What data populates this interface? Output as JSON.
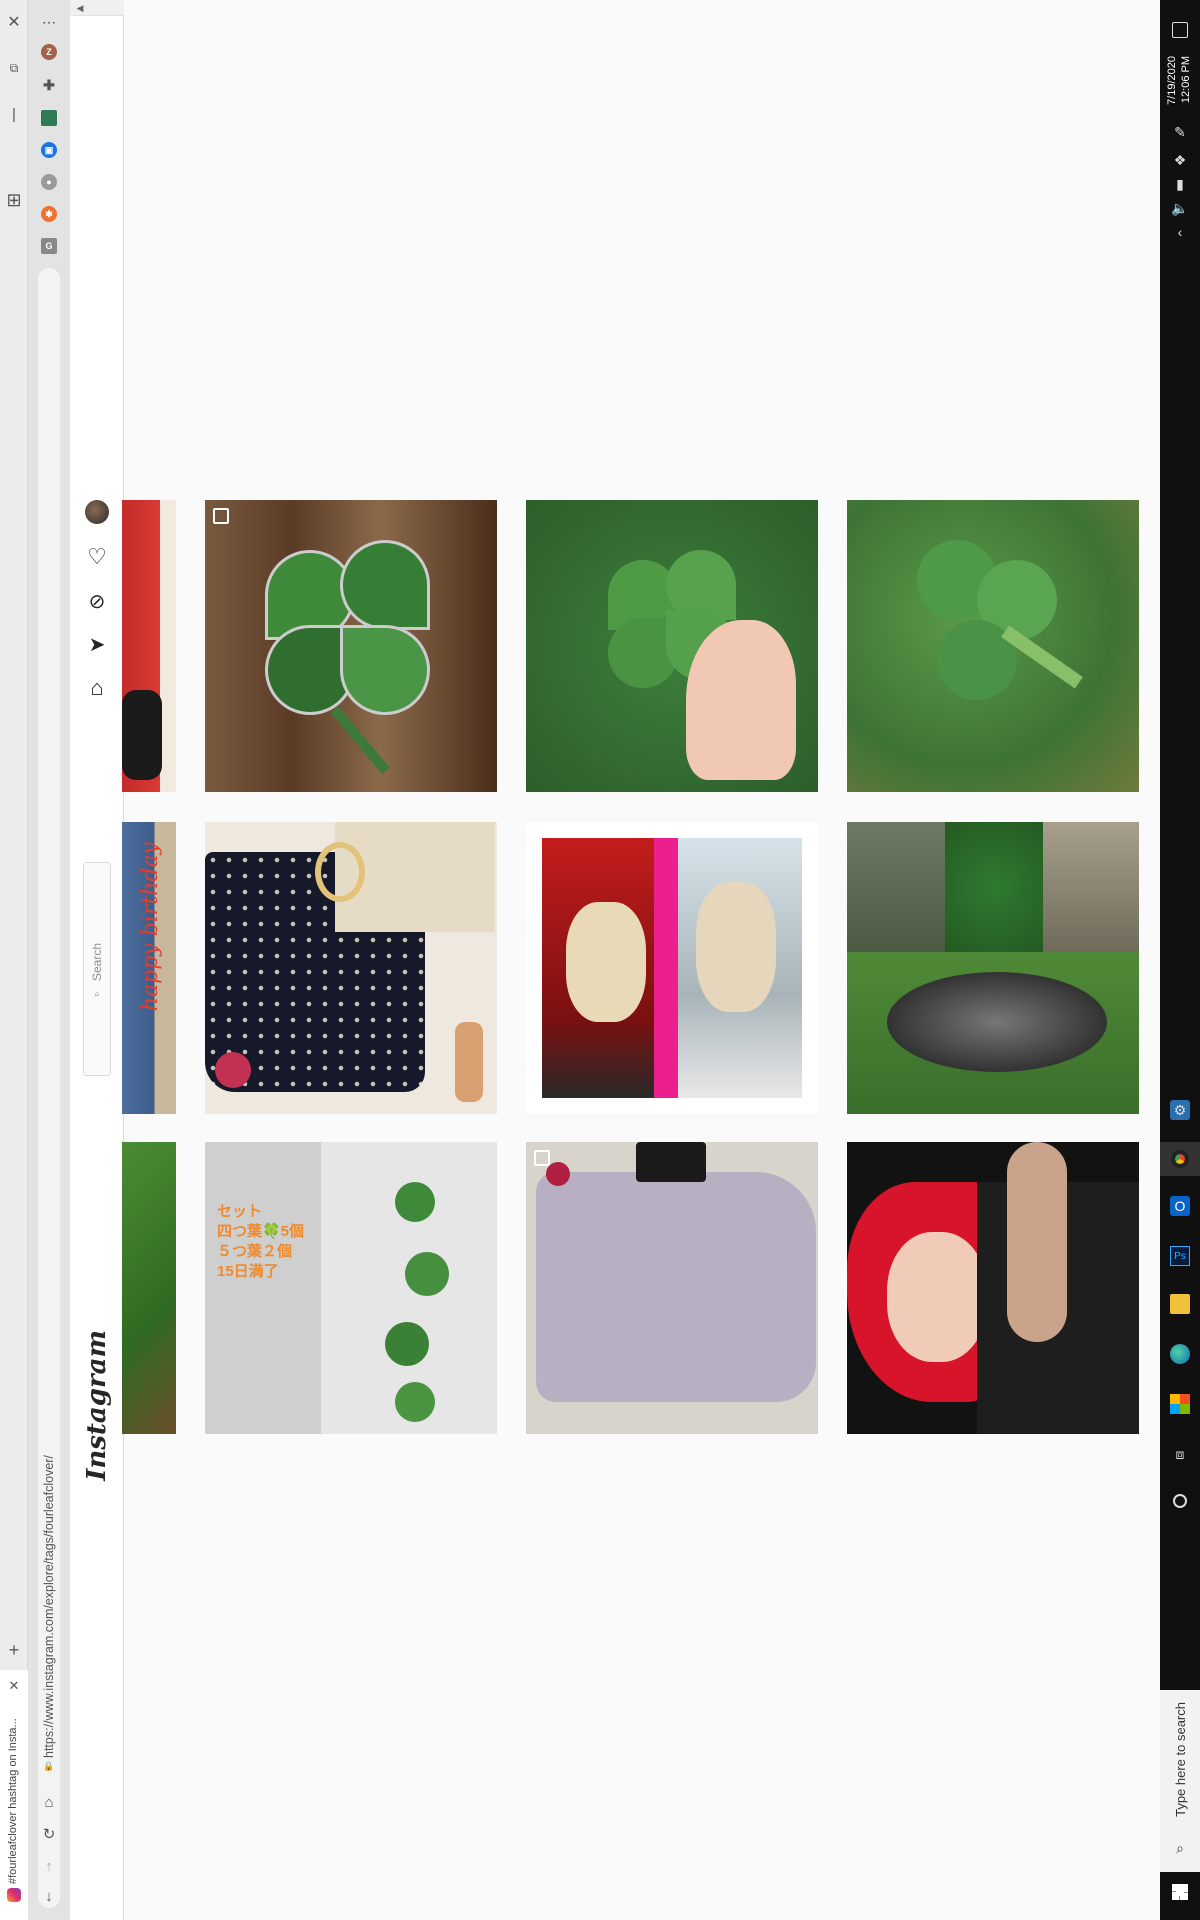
{
  "browser": {
    "tab_title": "#fourleafclover hashtag on Insta...",
    "address": "https://www.instagram.com/explore/tags/fourleafclover/",
    "profile_initial": "Z"
  },
  "instagram": {
    "logo": "Instagram",
    "search_placeholder": "Search"
  },
  "posts": [
    {
      "desc": "stained glass clover"
    },
    {
      "desc": "four leaf clover in hand"
    },
    {
      "desc": "clover patch"
    },
    {
      "desc": "polka dot dress"
    },
    {
      "desc": "anime collage"
    },
    {
      "desc": "dog collage"
    },
    {
      "desc": "clover sale"
    },
    {
      "desc": "lavender dress"
    },
    {
      "desc": "red hair selfie"
    }
  ],
  "partial_column": [
    {
      "caption": ""
    },
    {
      "caption": "happy birthday"
    },
    {
      "caption": ""
    }
  ],
  "clover_sale_text": [
    "セット",
    "四つ葉🍀5個",
    "５つ葉２個",
    "15日満了"
  ],
  "taskbar": {
    "time": "12:06 PM",
    "date": "7/19/2020",
    "search_placeholder": "Type here to search"
  },
  "colors": {
    "taskbar": "#101010",
    "page_bg": "#fafafa",
    "accent_orange": "#f08a2a"
  }
}
